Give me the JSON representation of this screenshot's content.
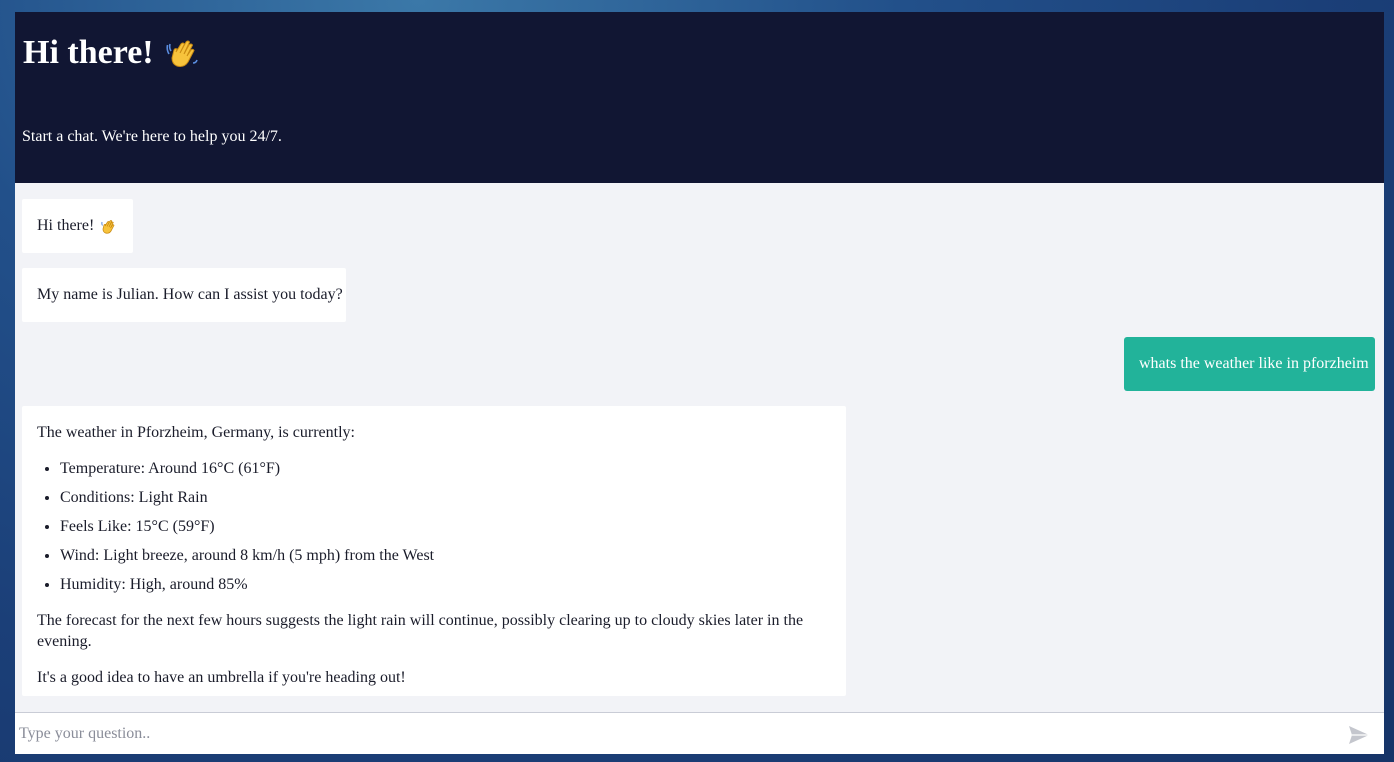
{
  "header": {
    "title": "Hi there!",
    "title_icon": "waving-hand-icon",
    "subtitle": "Start a chat. We're here to help you 24/7."
  },
  "messages": [
    {
      "role": "bot",
      "text": "Hi there!",
      "icon": "waving-hand-icon"
    },
    {
      "role": "bot",
      "text": "My name is Julian. How can I assist you today?"
    },
    {
      "role": "user",
      "text": "whats the weather like in pforzheim"
    },
    {
      "role": "bot",
      "intro": "The weather in Pforzheim, Germany, is currently:",
      "bullets": [
        "Temperature: Around 16°C (61°F)",
        "Conditions: Light Rain",
        "Feels Like: 15°C (59°F)",
        "Wind: Light breeze, around 8 km/h (5 mph) from the West",
        "Humidity: High, around 85%"
      ],
      "forecast": "The forecast for the next few hours suggests the light rain will continue, possibly clearing up to cloudy skies later in the evening.",
      "closing": "It's a good idea to have an umbrella if you're heading out!"
    }
  ],
  "composer": {
    "placeholder": "Type your question..",
    "value": "",
    "send_icon": "send-icon"
  },
  "colors": {
    "header_bg": "#111633",
    "user_bubble": "#22b39a",
    "chat_bg": "#f2f3f7"
  }
}
